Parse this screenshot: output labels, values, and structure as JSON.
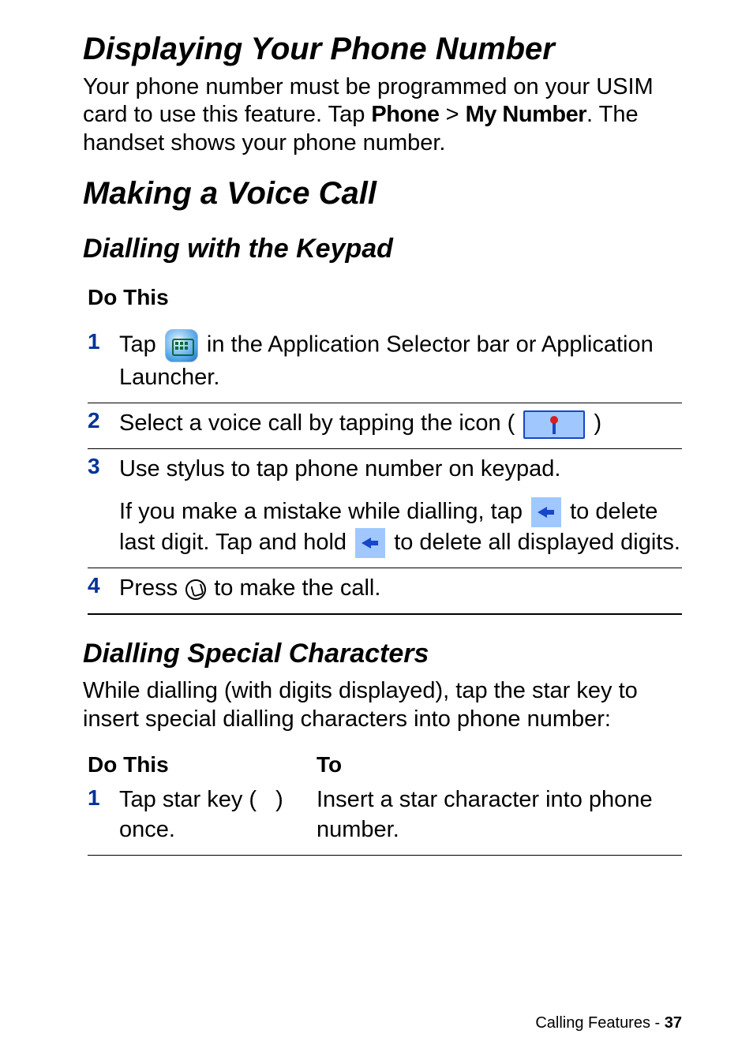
{
  "section1": {
    "title": "Displaying Your Phone Number",
    "para_a": "Your phone number must be programmed on your USIM card to use this feature. Tap ",
    "ui_phone": "Phone",
    "gt": " > ",
    "ui_mynum": "My Number",
    "para_b": ". The handset shows your phone number."
  },
  "section2": {
    "title": "Making a Voice Call",
    "sub1": {
      "title": "Dialling with the Keypad",
      "do_this": "Do This",
      "steps": [
        {
          "n": "1",
          "pre": "Tap ",
          "post": " in the Application Selector bar or Application Launcher."
        },
        {
          "n": "2",
          "pre": "Select a voice call by tapping the icon (",
          "post": ")"
        },
        {
          "n": "3",
          "line1": "Use stylus to tap phone number on keypad.",
          "line2a": "If you make a mistake while dialling, tap ",
          "line2b": " to delete last digit. Tap and hold ",
          "line2c": " to delete all displayed digits."
        },
        {
          "n": "4",
          "pre": "Press ",
          "post": " to make the call."
        }
      ]
    },
    "sub2": {
      "title": "Dialling Special Characters",
      "para": "While dialling (with digits displayed), tap the star key to insert special dialling characters into phone number:",
      "head_left": "Do This",
      "head_right": "To",
      "rows": [
        {
          "n": "1",
          "left_a": "Tap star key (",
          "left_b": ") once.",
          "right": "Insert a star character into phone number."
        }
      ]
    }
  },
  "footer": {
    "label": "Calling Features - ",
    "page": "37"
  }
}
